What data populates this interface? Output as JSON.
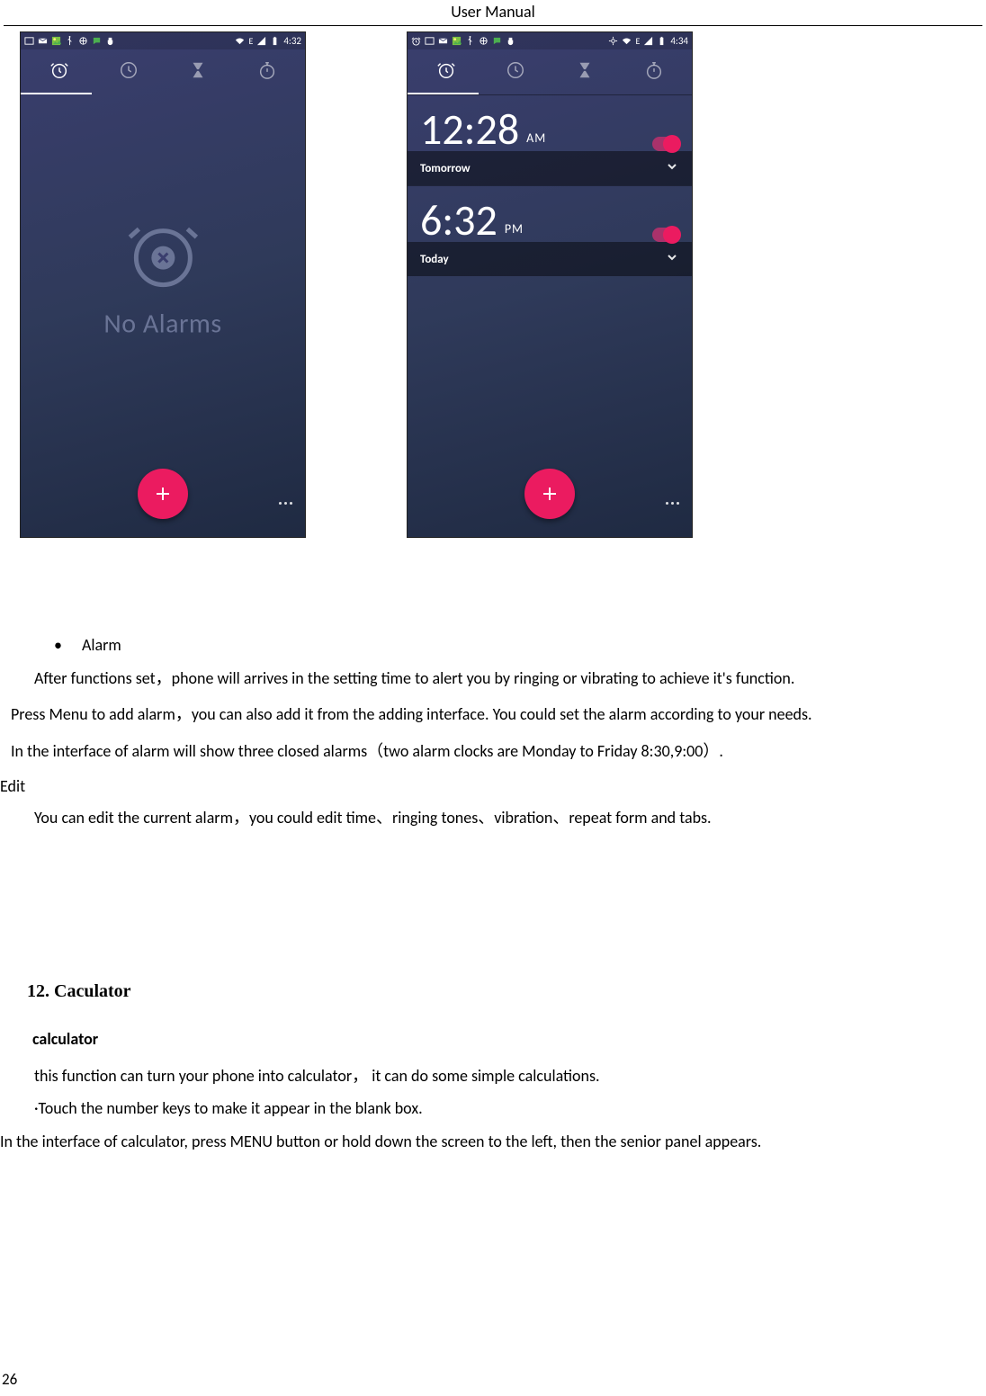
{
  "header": {
    "title": "User    Manual"
  },
  "page_number": "26",
  "screens": {
    "left": {
      "status": {
        "time": "4:32",
        "net": "E"
      },
      "no_alarms_label": "No Alarms"
    },
    "right": {
      "status": {
        "time": "4:34",
        "net": "E"
      },
      "alarms": [
        {
          "time": "12:28",
          "ampm": "AM",
          "day": "Tomorrow"
        },
        {
          "time": "6:32",
          "ampm": "PM",
          "day": "Today"
        }
      ]
    }
  },
  "body": {
    "bullet_alarm": "Alarm",
    "p1": "After functions set，phone will arrives in the setting time to alert you by ringing or vibrating to achieve it's function.",
    "p2": "Press Menu to add alarm，you can also add it from the adding interface. You could set the alarm according to your needs.",
    "p3": "In the interface of alarm will show three closed alarms（two alarm clocks are Monday to Friday 8:30,9:00）.",
    "edit_h": "Edit",
    "p4": "You can edit the current alarm，you could edit time、ringing tones、vibration、repeat form and tabs.",
    "sec12": "12. Caculator",
    "calc_h": "calculator",
    "p5": "this function can turn your phone into calculator，   it can do some simple calculations.",
    "p6": "·Touch the number keys to make it appear in the blank box.",
    "p7": "In the interface of calculator, press MENU button or hold down the screen to the left, then the senior panel appears."
  }
}
